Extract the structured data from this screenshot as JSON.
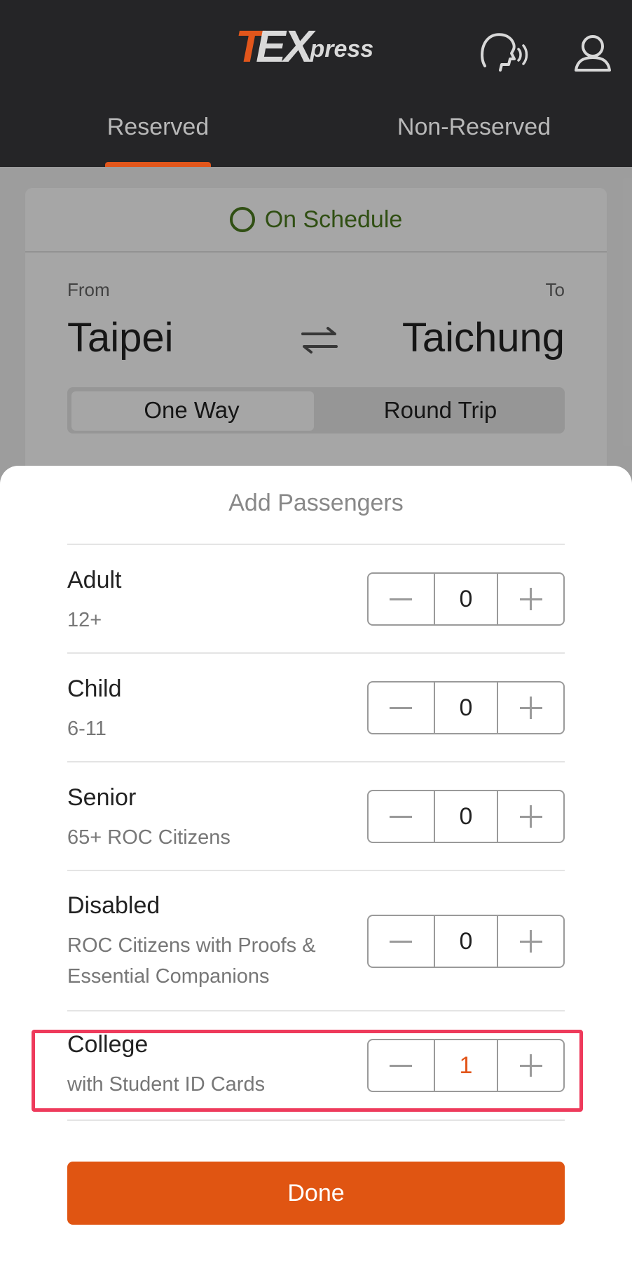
{
  "header": {
    "logo": {
      "t": "T",
      "ex": "EX",
      "press": "press"
    },
    "tabs": [
      {
        "label": "Reserved",
        "active": true
      },
      {
        "label": "Non-Reserved",
        "active": false
      }
    ],
    "icons": [
      "voice-assistant-icon",
      "user-profile-icon"
    ]
  },
  "schedule": {
    "status": "On Schedule",
    "status_color": "#4a7a1e"
  },
  "route": {
    "from_label": "From",
    "to_label": "To",
    "from_city": "Taipei",
    "to_city": "Taichung",
    "trip_types": [
      "One Way",
      "Round Trip"
    ],
    "selected_trip_type": "One Way"
  },
  "passengers": {
    "title": "Add Passengers",
    "rows": [
      {
        "name": "Adult",
        "desc": "12+",
        "count": "0"
      },
      {
        "name": "Child",
        "desc": "6-11",
        "count": "0"
      },
      {
        "name": "Senior",
        "desc": "65+ ROC Citizens",
        "count": "0"
      },
      {
        "name": "Disabled",
        "desc": "ROC Citizens with Proofs & Essential Companions",
        "count": "0"
      },
      {
        "name": "College",
        "desc": "with Student ID Cards",
        "count": "1"
      }
    ],
    "done_label": "Done"
  },
  "colors": {
    "accent": "#e2561b",
    "header_bg": "#252527",
    "highlight": "#ee3a5b"
  }
}
